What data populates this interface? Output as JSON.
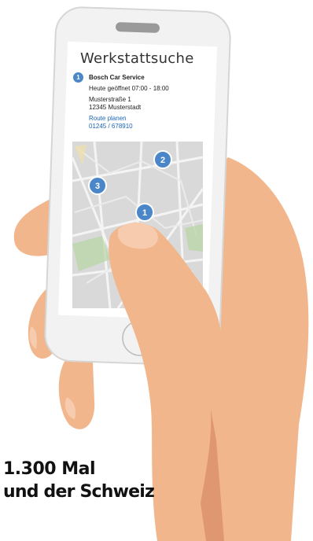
{
  "app": {
    "title": "Werkstattsuche"
  },
  "result": {
    "index": "1",
    "name": "Bosch Car Service",
    "hours": "Heute geöffnet 07:00 - 18:00",
    "street": "Musterstraße 1",
    "city": "12345 Musterstadt",
    "route_link": "Route planen",
    "phone": "01245 / 678910"
  },
  "map": {
    "markers": [
      "1",
      "2",
      "3"
    ],
    "marker_color": "#4a86c8"
  },
  "caption": {
    "line1": "1.300 Mal",
    "line2": "und der Schweiz"
  },
  "colors": {
    "skin": "#f2b68c",
    "skin_shadow": "#d9906a",
    "phone_frame": "#f2f2f2"
  }
}
